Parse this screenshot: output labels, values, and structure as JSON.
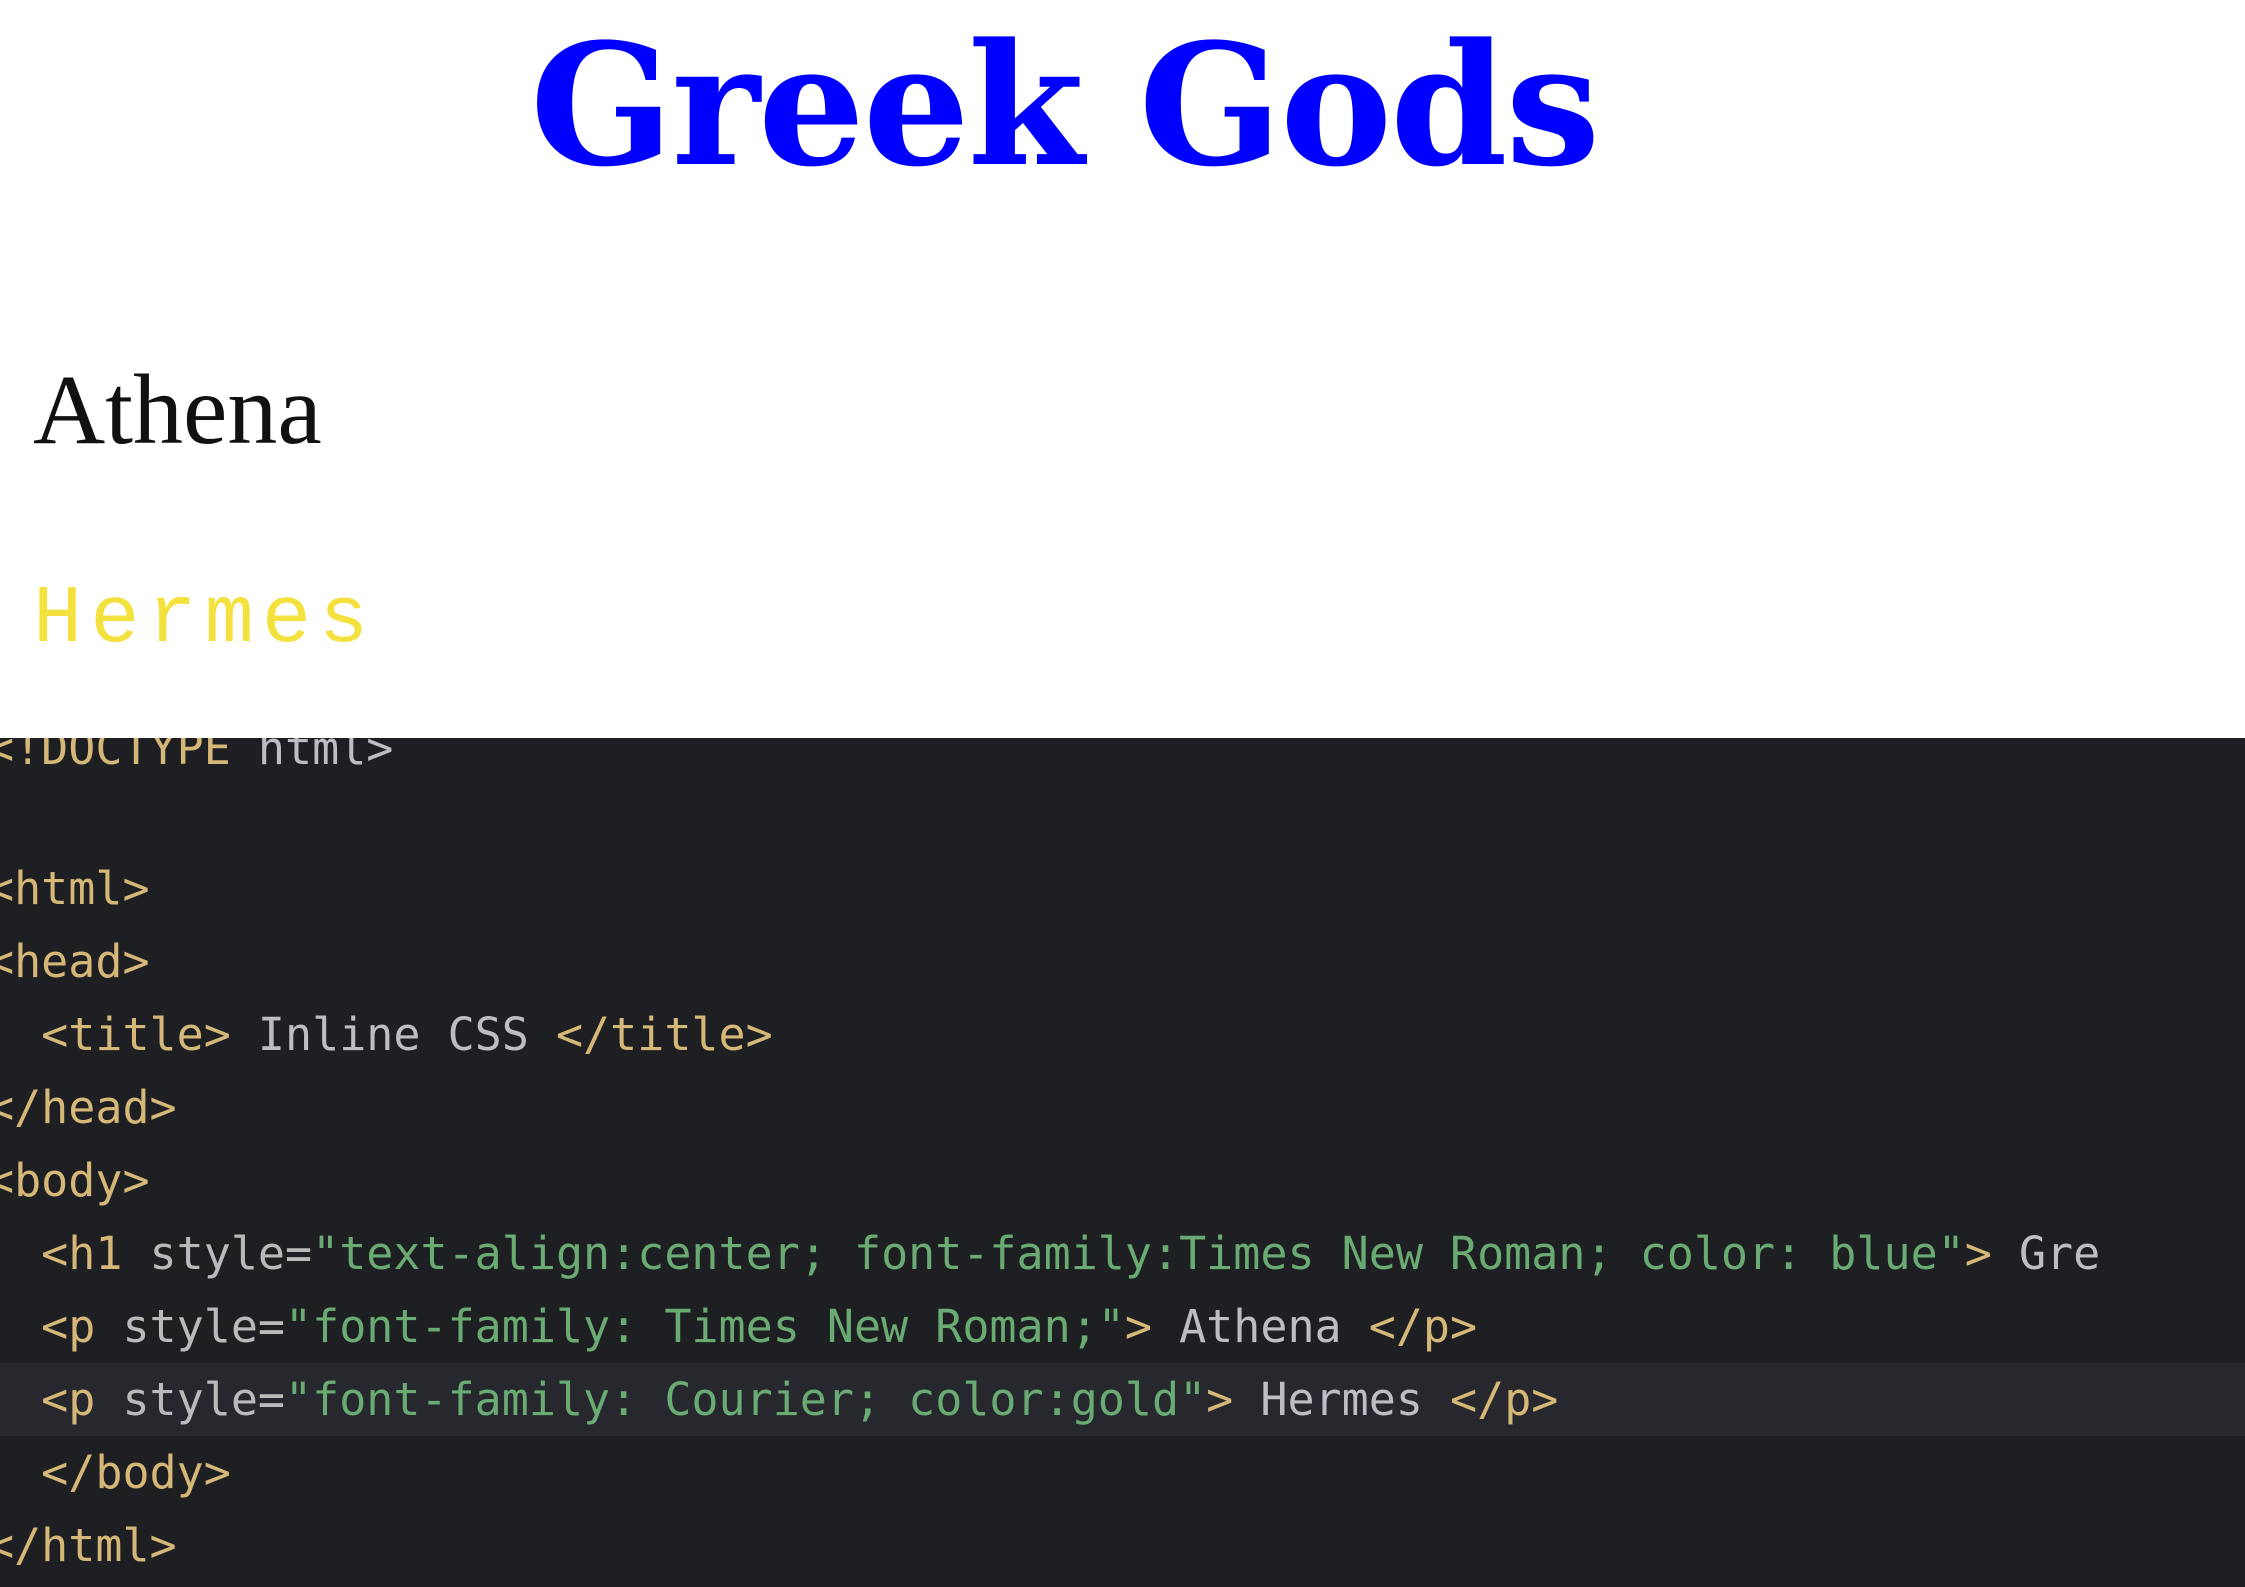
{
  "preview": {
    "heading": "Greek Gods",
    "athena": "Athena",
    "hermes": "Hermes"
  },
  "colors": {
    "heading": "#0000ff",
    "hermes": "#f3e13e",
    "editor_bg": "#1e1f22",
    "tag": "#d5b778",
    "string": "#6aab73",
    "text": "#bcbec4"
  },
  "code": {
    "doctype_tag": "<!DOCTYPE",
    "doctype_rest": " html>",
    "html_open": "<html>",
    "head_open": "<head>",
    "title_open": "  <title>",
    "title_text": " Inline CSS ",
    "title_close": "</title>",
    "head_close": "</head>",
    "body_open": "<body>",
    "h1_open": "  <h1",
    "h1_attr": " style=",
    "h1_value": "\"text-align:center; font-family:Times New Roman; color: blue\"",
    "h1_gt": ">",
    "h1_text": " Gre",
    "p1_open": "  <p",
    "p1_attr": " style=",
    "p1_value": "\"font-family: Times New Roman;\"",
    "p1_gt": ">",
    "p1_text": " Athena ",
    "p1_close": "</p>",
    "p2_open": "  <p",
    "p2_attr": " style=",
    "p2_value": "\"font-family: Courier; color:gold\"",
    "p2_gt": ">",
    "p2_text": " Hermes ",
    "p2_close": "</p>",
    "body_close": "  </body>",
    "html_close": "</html>"
  }
}
